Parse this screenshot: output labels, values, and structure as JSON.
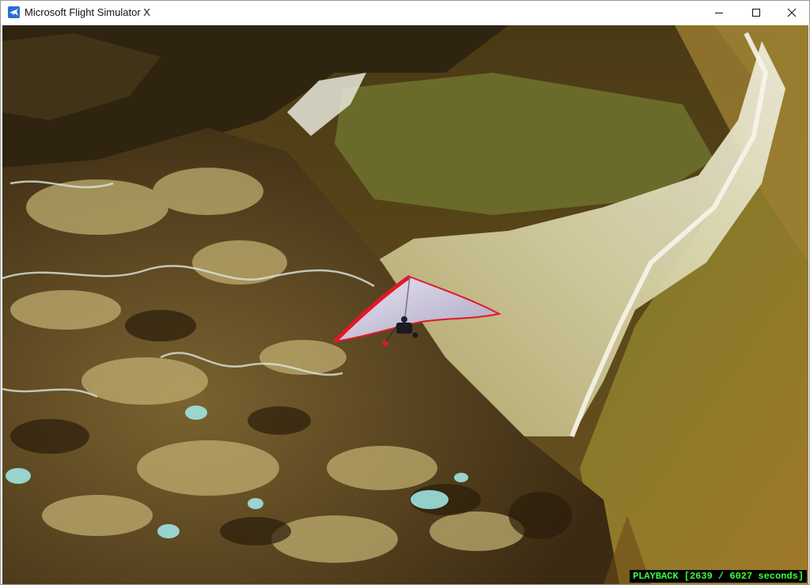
{
  "window": {
    "title": "Microsoft Flight Simulator X",
    "app_icon": "airplane-icon",
    "controls": [
      "minimize-icon",
      "maximize-icon",
      "close-icon"
    ]
  },
  "scene": {
    "description_icon": "hang-glider",
    "colors": {
      "wing_top": "#d9d3e6",
      "wing_edge": "#e0182a",
      "terrain_dark": "#3b2a12",
      "terrain_light": "#cdbf8a",
      "riverbed": "#e6e2c4",
      "ice": "#9fe3e0"
    }
  },
  "status": {
    "playback_text": "PLAYBACK [2639 / 6027 seconds]",
    "text_color": "#3cff3c"
  }
}
